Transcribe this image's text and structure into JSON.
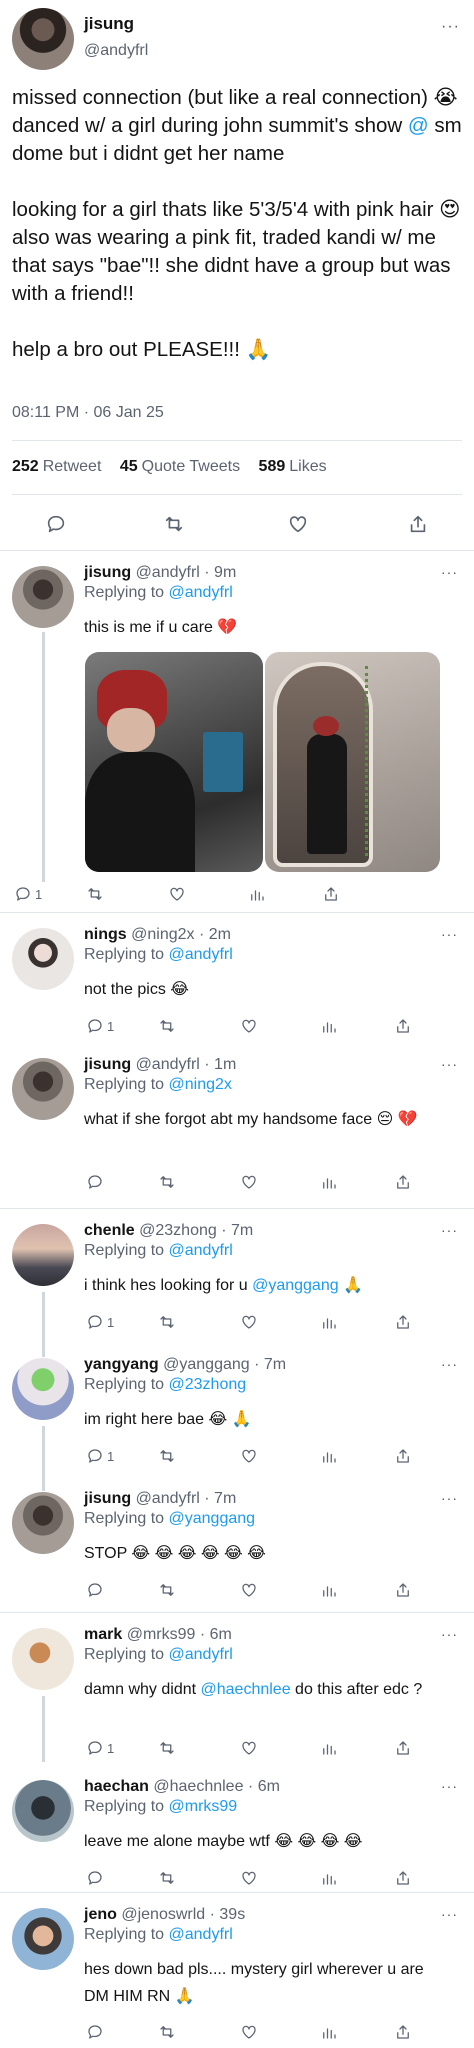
{
  "main": {
    "name": "jisung",
    "handle": "@andyfrl",
    "body_part1": "missed connection (but like a real connection) 😭 danced w/ a girl during john summit's show ",
    "body_at": "@",
    "body_part2": " sm dome but i didnt get her name\n\nlooking for a girl thats like 5'3/5'4 with pink hair 😍 also was wearing a pink fit, traded kandi w/ me that says \"bae\"!! she didnt have a group but was with a friend!!\n\nhelp a bro out PLEASE!!! 🙏",
    "timestamp": "08:11 PM · 06 Jan 25",
    "retweets_count": "252",
    "retweets_label": "Retweet",
    "quotes_count": "45",
    "quotes_label": "Quote Tweets",
    "likes_count": "589",
    "likes_label": "Likes",
    "more": "···"
  },
  "replies": [
    {
      "name": "jisung",
      "handle": "@andyfrl",
      "time": "· 9m",
      "replying_label": "Replying to",
      "replying_to": "@andyfrl",
      "text": "this is me if u care 💔",
      "reply_count": "1"
    },
    {
      "name": "nings",
      "handle": "@ning2x",
      "time": "· 2m",
      "replying_label": "Replying to",
      "replying_to": "@andyfrl",
      "text": "not the pics 😂",
      "reply_count": "1"
    },
    {
      "name": "jisung",
      "handle": "@andyfrl",
      "time": "· 1m",
      "replying_label": "Replying to",
      "replying_to": "@ning2x",
      "text": "what if she forgot abt my handsome face 😔 💔",
      "reply_count": ""
    },
    {
      "name": "chenle",
      "handle": "@23zhong",
      "time": "· 7m",
      "replying_label": "Replying to",
      "replying_to": "@andyfrl",
      "text_pre": "i think hes looking for u ",
      "text_link": "@yanggang",
      "text_post": " 🙏",
      "reply_count": "1"
    },
    {
      "name": "yangyang",
      "handle": "@yanggang",
      "time": "· 7m",
      "replying_label": "Replying to",
      "replying_to": "@23zhong",
      "text": "im right here bae 😂 🙏",
      "reply_count": "1"
    },
    {
      "name": "jisung",
      "handle": "@andyfrl",
      "time": "· 7m",
      "replying_label": "Replying to",
      "replying_to": "@yanggang",
      "text": "STOP 😂 😂 😂 😂 😂 😂",
      "reply_count": ""
    },
    {
      "name": "mark",
      "handle": "@mrks99",
      "time": "· 6m",
      "replying_label": "Replying to",
      "replying_to": "@andyfrl",
      "text_pre": "damn why didnt ",
      "text_link": "@haechnlee",
      "text_post": " do this after edc ?",
      "reply_count": "1"
    },
    {
      "name": "haechan",
      "handle": "@haechnlee",
      "time": "· 6m",
      "replying_label": "Replying to",
      "replying_to": "@mrks99",
      "text": "leave me alone maybe wtf 😂 😂 😂 😂",
      "reply_count": ""
    },
    {
      "name": "jeno",
      "handle": "@jenoswrld",
      "time": "· 39s",
      "replying_label": "Replying to",
      "replying_to": "@andyfrl",
      "text": "hes down bad pls.... mystery girl wherever u are DM HIM RN 🙏",
      "reply_count": ""
    }
  ],
  "more": "···",
  "icons": [
    "reply-icon",
    "retweet-icon",
    "like-icon",
    "analytics-icon",
    "share-icon"
  ],
  "colors": {
    "link": "#1d9bf0",
    "muted": "#5b6470",
    "divider": "#e2e6ea"
  }
}
